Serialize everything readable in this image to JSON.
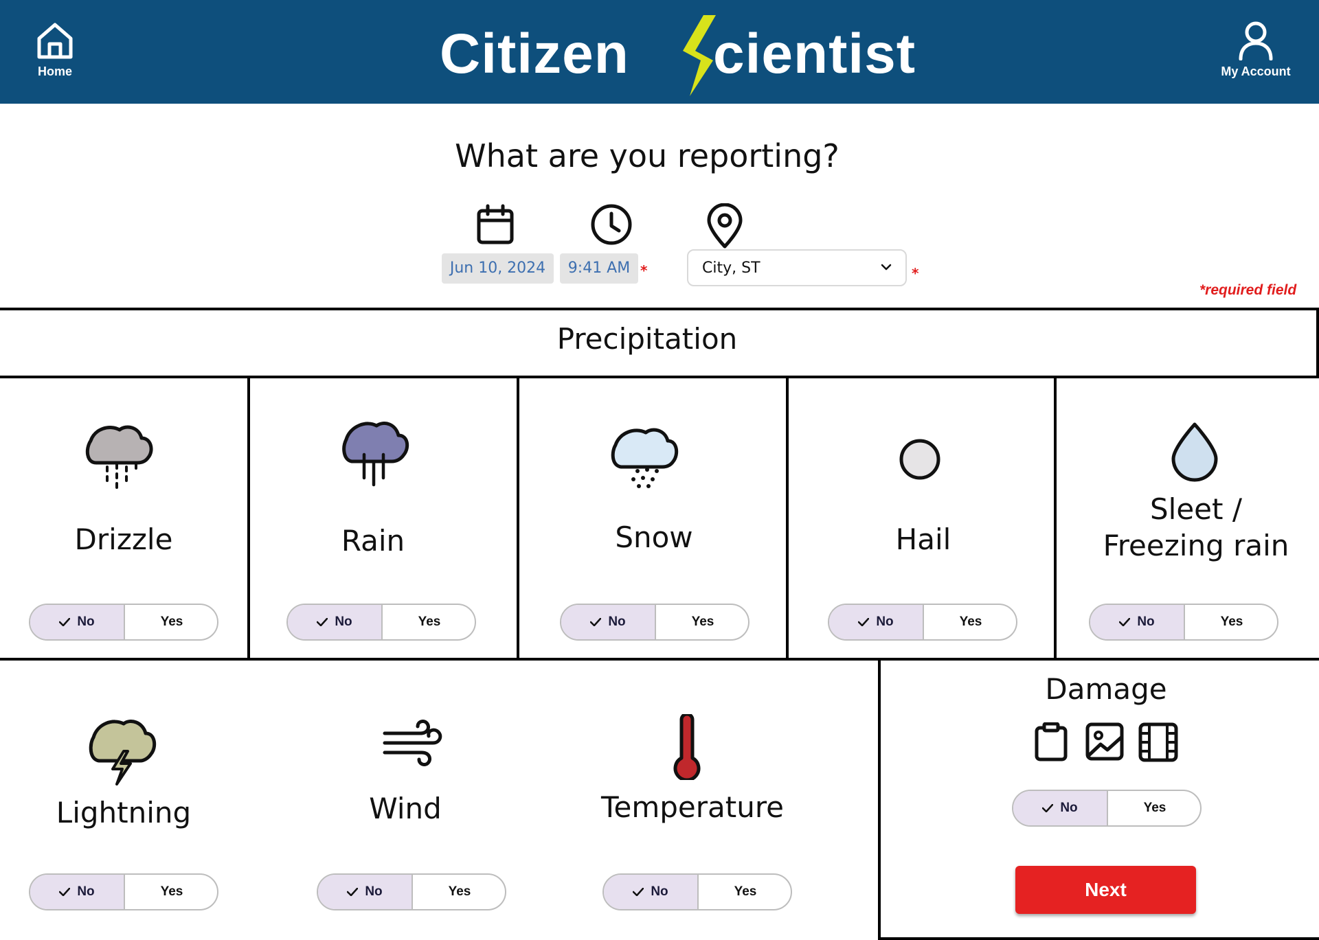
{
  "header": {
    "home_label": "Home",
    "brand_word1": "Citizen",
    "brand_word2": "cientist",
    "account_label": "My Account",
    "bg_color": "#0e4f7c",
    "bolt_color": "#d8e21b"
  },
  "report": {
    "question": "What are you reporting?",
    "date": "Jun 10, 2024",
    "time": "9:41 AM",
    "location": "City, ST",
    "required_star": "*",
    "required_note": "*required field"
  },
  "precipitation": {
    "title": "Precipitation",
    "items": [
      {
        "label": "Drizzle",
        "icon": "drizzle-cloud-icon",
        "selected": "No"
      },
      {
        "label": "Rain",
        "icon": "rain-cloud-icon",
        "selected": "No"
      },
      {
        "label": "Snow",
        "icon": "snow-cloud-icon",
        "selected": "No"
      },
      {
        "label": "Hail",
        "icon": "hail-icon",
        "selected": "No"
      },
      {
        "label_line1": "Sleet /",
        "label_line2": "Freezing rain",
        "icon": "droplet-icon",
        "selected": "No"
      }
    ]
  },
  "other": {
    "items": [
      {
        "label": "Lightning",
        "icon": "lightning-cloud-icon",
        "selected": "No"
      },
      {
        "label": "Wind",
        "icon": "wind-icon",
        "selected": "No"
      },
      {
        "label": "Temperature",
        "icon": "thermometer-icon",
        "selected": "No"
      }
    ]
  },
  "damage": {
    "title": "Damage",
    "icons": [
      "clipboard-icon",
      "image-icon",
      "video-icon"
    ],
    "selected": "No"
  },
  "toggle": {
    "no": "No",
    "yes": "Yes"
  },
  "next_label": "Next",
  "colors": {
    "accent_red": "#e52222",
    "toggle_selected": "#e7e0ef"
  }
}
